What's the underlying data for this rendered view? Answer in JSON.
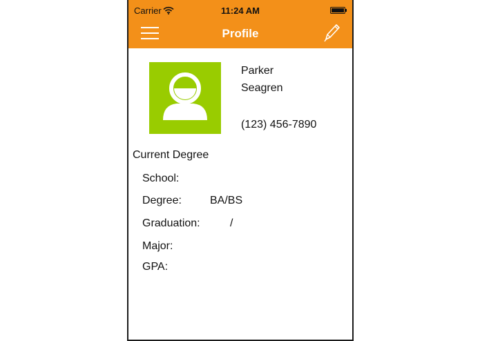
{
  "status_bar": {
    "carrier": "Carrier",
    "time": "11:24 AM",
    "battery_level": 1.0
  },
  "nav": {
    "title": "Profile",
    "left_icon": "menu-icon",
    "right_icon": "pencil-icon",
    "color": "#f39019"
  },
  "profile": {
    "first_name": "Parker",
    "last_name": "Seagren",
    "phone": "(123) 456-7890",
    "avatar_color": "#99cc00"
  },
  "degree": {
    "heading": "Current Degree",
    "school_label": "School:",
    "school_value": "",
    "degree_label": "Degree:",
    "degree_value": "BA/BS",
    "graduation_label": "Graduation:",
    "graduation_value": "/",
    "major_label": "Major:",
    "major_value": "",
    "gpa_label": "GPA:",
    "gpa_value": ""
  }
}
